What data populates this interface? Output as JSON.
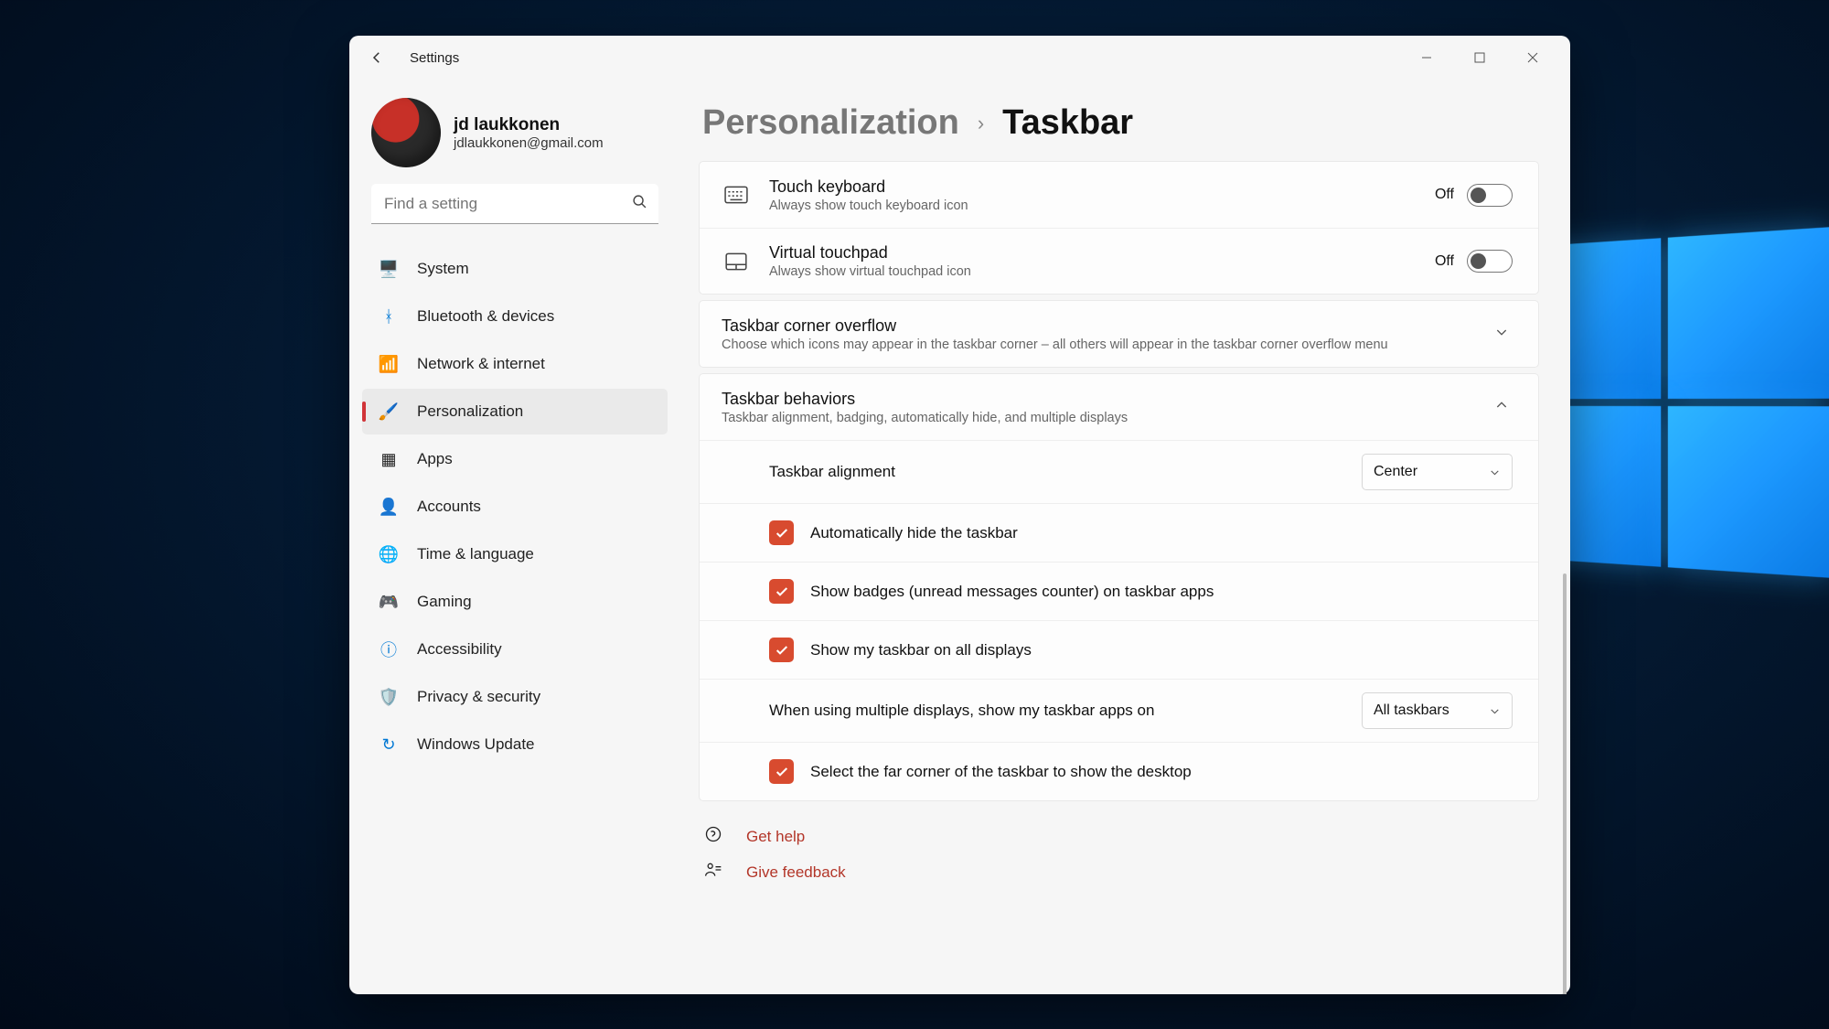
{
  "window": {
    "title": "Settings"
  },
  "profile": {
    "name": "jd laukkonen",
    "email": "jdlaukkonen@gmail.com"
  },
  "search": {
    "placeholder": "Find a setting"
  },
  "nav": [
    {
      "label": "System"
    },
    {
      "label": "Bluetooth & devices"
    },
    {
      "label": "Network & internet"
    },
    {
      "label": "Personalization"
    },
    {
      "label": "Apps"
    },
    {
      "label": "Accounts"
    },
    {
      "label": "Time & language"
    },
    {
      "label": "Gaming"
    },
    {
      "label": "Accessibility"
    },
    {
      "label": "Privacy & security"
    },
    {
      "label": "Windows Update"
    }
  ],
  "breadcrumb": {
    "parent": "Personalization",
    "current": "Taskbar"
  },
  "toggles": {
    "touch_keyboard": {
      "title": "Touch keyboard",
      "desc": "Always show touch keyboard icon",
      "state": "Off"
    },
    "virtual_touchpad": {
      "title": "Virtual touchpad",
      "desc": "Always show virtual touchpad icon",
      "state": "Off"
    }
  },
  "sections": {
    "overflow": {
      "title": "Taskbar corner overflow",
      "desc": "Choose which icons may appear in the taskbar corner – all others will appear in the taskbar corner overflow menu"
    },
    "behaviors": {
      "title": "Taskbar behaviors",
      "desc": "Taskbar alignment, badging, automatically hide, and multiple displays"
    }
  },
  "behaviors": {
    "alignment_label": "Taskbar alignment",
    "alignment_value": "Center",
    "auto_hide": "Automatically hide the taskbar",
    "badges": "Show badges (unread messages counter) on taskbar apps",
    "all_displays": "Show my taskbar on all displays",
    "multi_label": "When using multiple displays, show my taskbar apps on",
    "multi_value": "All taskbars",
    "far_corner": "Select the far corner of the taskbar to show the desktop"
  },
  "help": {
    "get_help": "Get help",
    "feedback": "Give feedback"
  }
}
